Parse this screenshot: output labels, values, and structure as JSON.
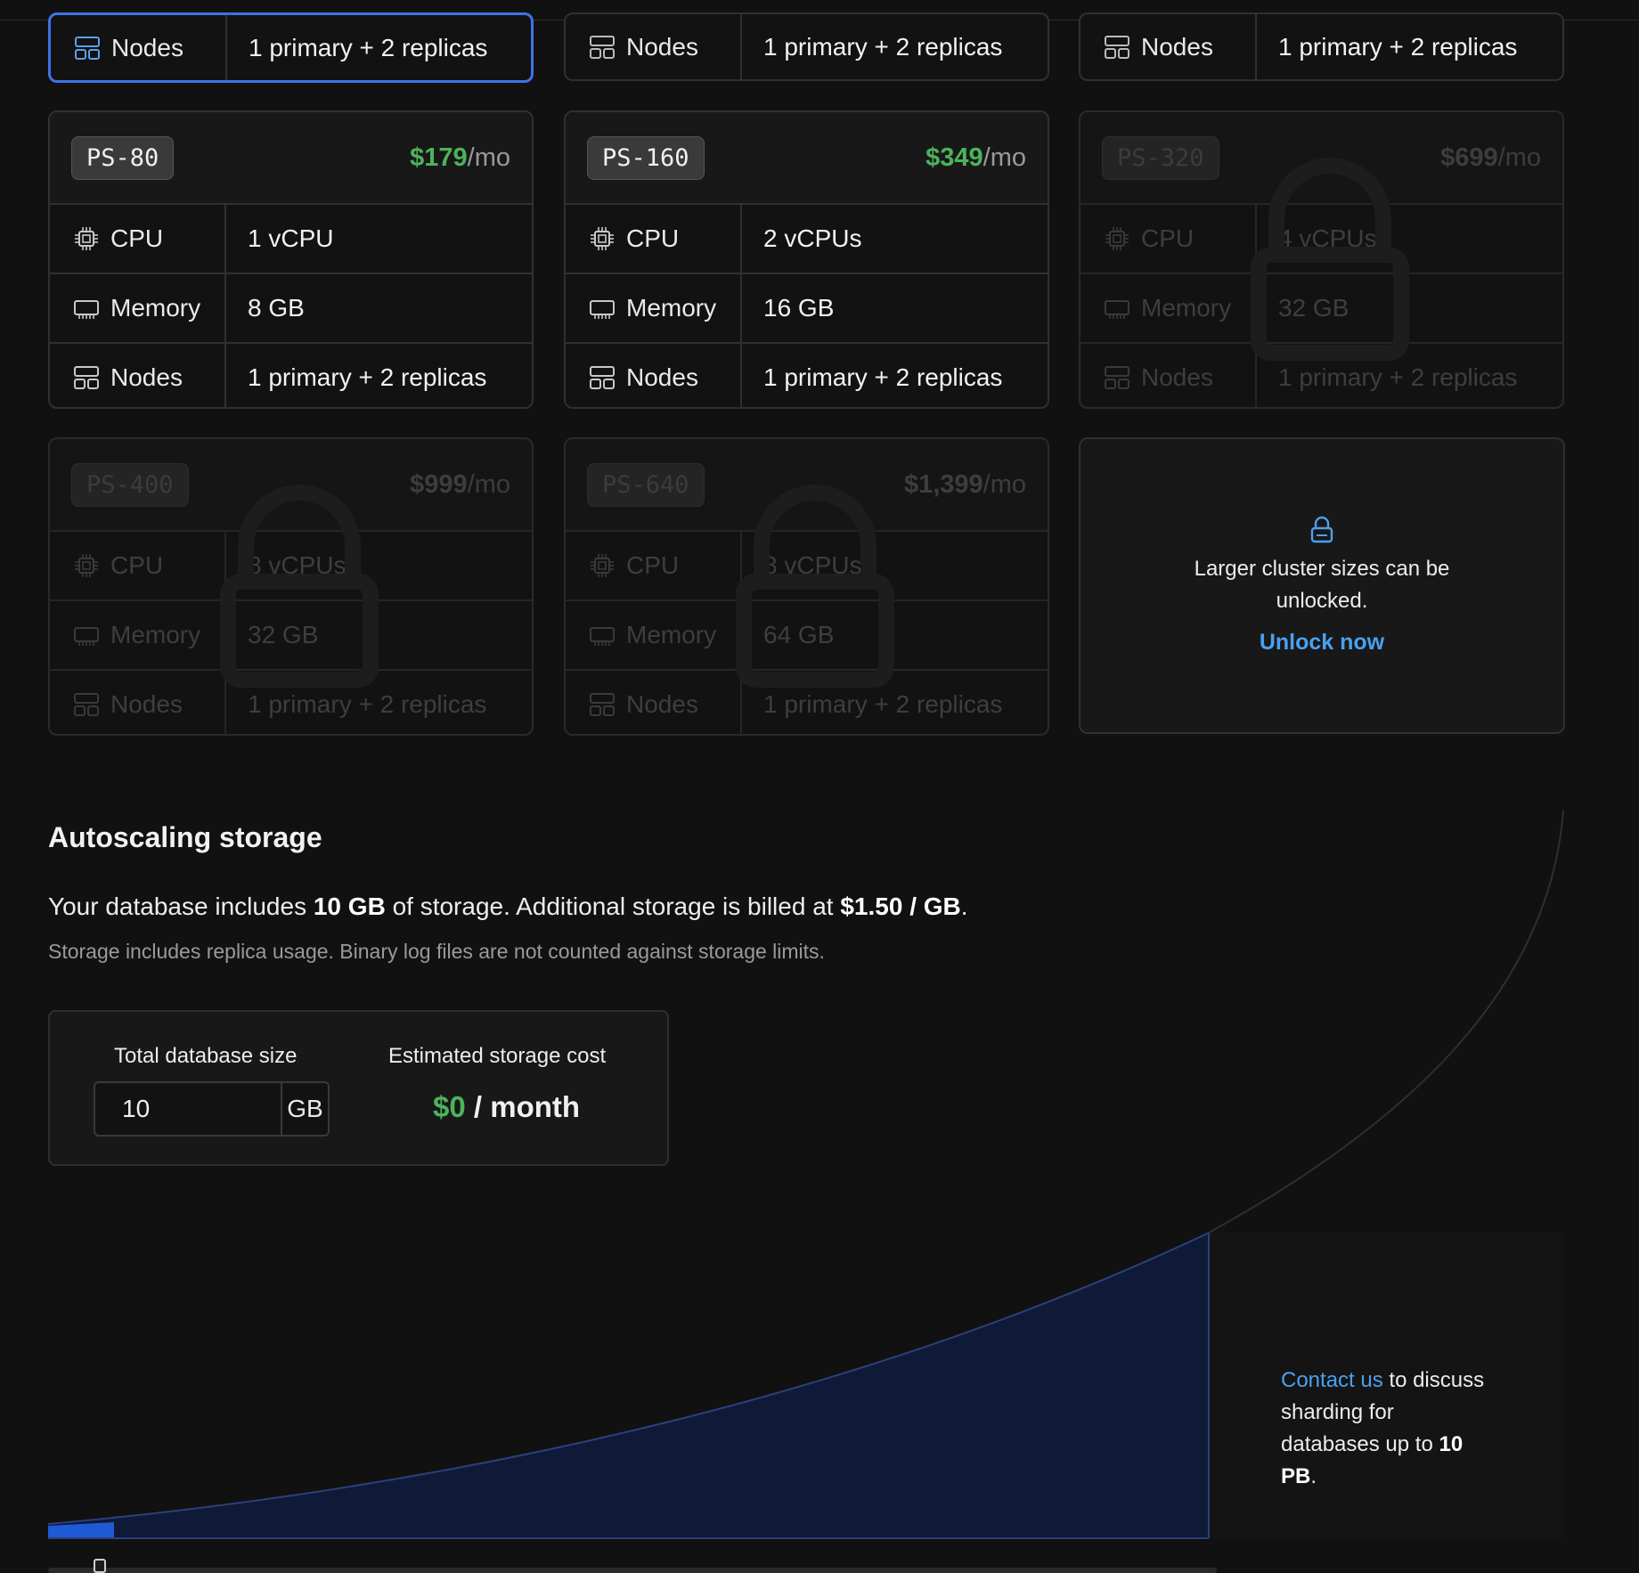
{
  "top_row": [
    {
      "nodes_label": "Nodes",
      "nodes_value": "1 primary + 2 replicas"
    },
    {
      "nodes_label": "Nodes",
      "nodes_value": "1 primary + 2 replicas"
    },
    {
      "nodes_label": "Nodes",
      "nodes_value": "1 primary + 2 replicas"
    }
  ],
  "clusters": [
    {
      "name": "PS-80",
      "price": "$179",
      "per": "/mo",
      "cpu_label": "CPU",
      "cpu": "1 vCPU",
      "memory_label": "Memory",
      "memory": "8 GB",
      "nodes_label": "Nodes",
      "nodes": "1 primary + 2 replicas",
      "locked": false
    },
    {
      "name": "PS-160",
      "price": "$349",
      "per": "/mo",
      "cpu_label": "CPU",
      "cpu": "2 vCPUs",
      "memory_label": "Memory",
      "memory": "16 GB",
      "nodes_label": "Nodes",
      "nodes": "1 primary + 2 replicas",
      "locked": false
    },
    {
      "name": "PS-320",
      "price": "$699",
      "per": "/mo",
      "cpu_label": "CPU",
      "cpu": "4 vCPUs",
      "memory_label": "Memory",
      "memory": "32 GB",
      "nodes_label": "Nodes",
      "nodes": "1 primary + 2 replicas",
      "locked": true
    },
    {
      "name": "PS-400",
      "price": "$999",
      "per": "/mo",
      "cpu_label": "CPU",
      "cpu": "8 vCPUs",
      "memory_label": "Memory",
      "memory": "32 GB",
      "nodes_label": "Nodes",
      "nodes": "1 primary + 2 replicas",
      "locked": true
    },
    {
      "name": "PS-640",
      "price": "$1,399",
      "per": "/mo",
      "cpu_label": "CPU",
      "cpu": "8 vCPUs",
      "memory_label": "Memory",
      "memory": "64 GB",
      "nodes_label": "Nodes",
      "nodes": "1 primary + 2 replicas",
      "locked": true
    }
  ],
  "unlock": {
    "text": "Larger cluster sizes can be unlocked.",
    "link": "Unlock now",
    "icon": "lock-icon"
  },
  "storage": {
    "title": "Autoscaling storage",
    "desc_1": "Your database includes ",
    "desc_included": "10 GB",
    "desc_2": " of storage. Additional storage is billed at ",
    "desc_rate": "$1.50 / GB",
    "desc_3": ".",
    "note": "Storage includes replica usage. Binary log files are not counted against storage limits.",
    "size_label": "Total database size",
    "size_value": "10",
    "size_unit": "GB",
    "cost_label": "Estimated storage cost",
    "cost_amount": "$0",
    "cost_suffix": " / month",
    "contact_link": "Contact us",
    "contact_text_1": " to discuss sharding for databases up to ",
    "contact_max": "10 PB",
    "contact_text_2": ".",
    "slider_fraction": 0.004
  },
  "colors": {
    "accent_blue": "#4aa0f0",
    "price_green": "#4cb35a",
    "selected_border": "#3d73e6",
    "chart_fill": "#0f1a38",
    "chart_selected": "#1f5ad6"
  }
}
